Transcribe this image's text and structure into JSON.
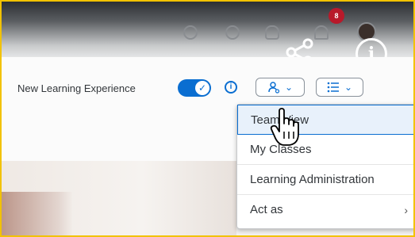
{
  "shellbar": {
    "notification_count": "8",
    "icons": [
      "location-icon",
      "check-circle-icon",
      "headset-icon",
      "bell-icon",
      "avatar"
    ]
  },
  "overlay": {
    "share_icon": "share-icon",
    "info_symbol": "i"
  },
  "toolbar": {
    "new_learning_label": "New Learning Experience",
    "toggle_on": true,
    "info_symbol": "i",
    "person_menu_caret": "⌄",
    "list_menu_caret": "⌄"
  },
  "menu": {
    "items": [
      {
        "label": "Team View"
      },
      {
        "label": "My Classes"
      },
      {
        "label": "Learning Administration"
      },
      {
        "label": "Act as",
        "submenu_chevron": "›"
      }
    ]
  },
  "colors": {
    "accent": "#0a6ed1",
    "frame": "#f2c200",
    "badge": "#b8192a"
  }
}
